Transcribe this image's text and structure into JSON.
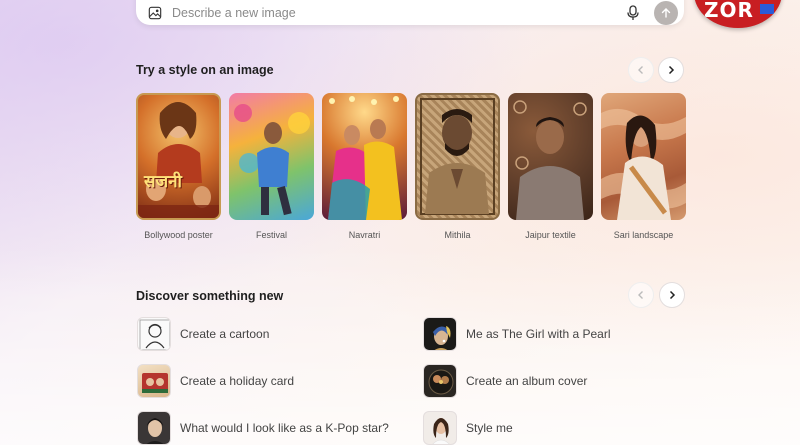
{
  "prompt": {
    "placeholder": "Describe a new image",
    "icon": "image-icon"
  },
  "logo": {
    "text": "ZOR"
  },
  "styles_section": {
    "title": "Try a style on an image",
    "items": [
      {
        "label": "Bollywood poster",
        "poster_text": "सजनी"
      },
      {
        "label": "Festival"
      },
      {
        "label": "Navratri"
      },
      {
        "label": "Mithila"
      },
      {
        "label": "Jaipur textile"
      },
      {
        "label": "Sari landscape"
      }
    ]
  },
  "discover_section": {
    "title": "Discover something new",
    "items": [
      {
        "label": "Create a cartoon"
      },
      {
        "label": "Me as The Girl with a Pearl"
      },
      {
        "label": "Create a holiday card"
      },
      {
        "label": "Create an album cover"
      },
      {
        "label": "What would I look like as a K-Pop star?"
      },
      {
        "label": "Style me"
      }
    ]
  },
  "colors": {
    "send_button": "#b9b4b2",
    "logo_red": "#c81e22"
  }
}
